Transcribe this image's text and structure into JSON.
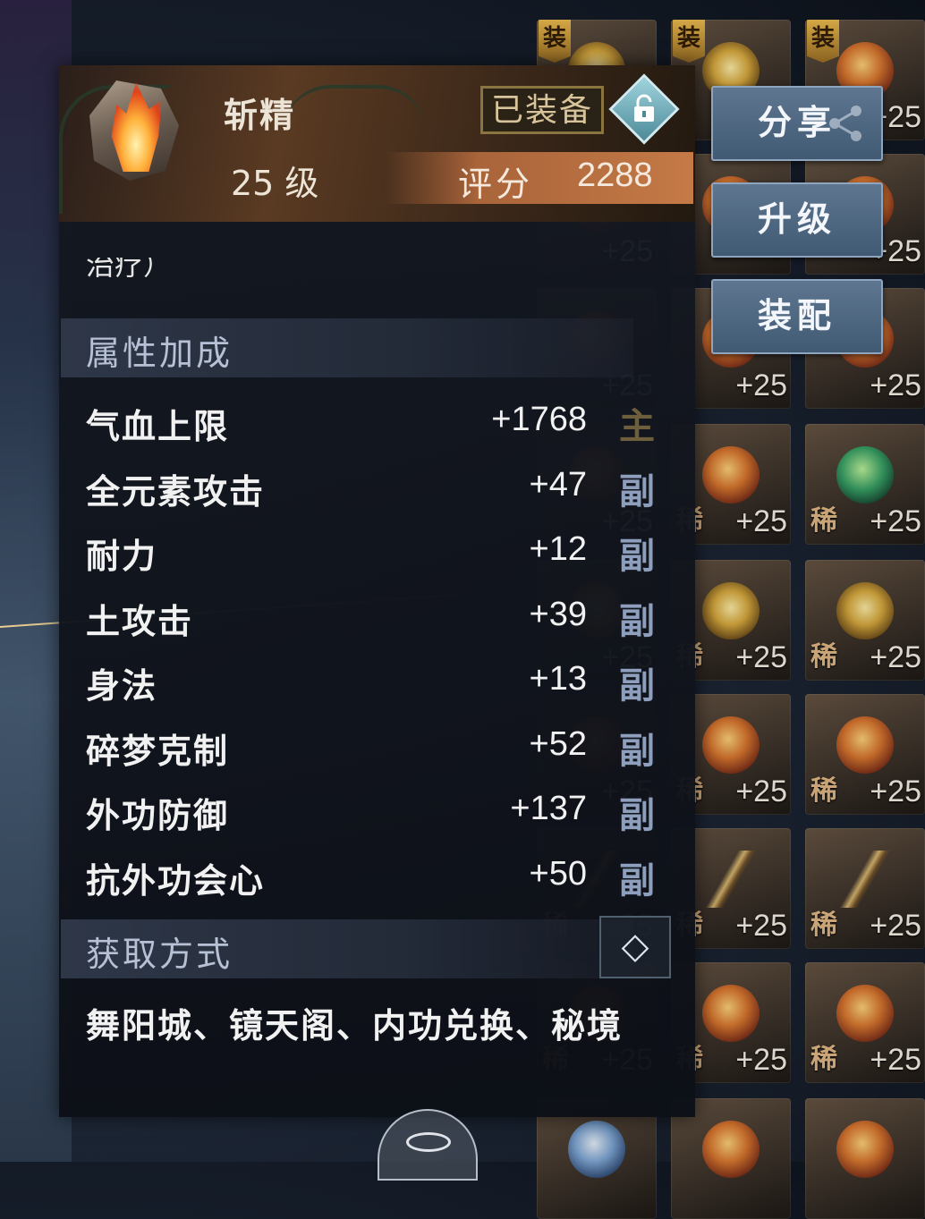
{
  "item": {
    "name": "斩精",
    "equipped_label": "已装备",
    "level_label": "25 级",
    "score_label": "评分",
    "score_value": "2288"
  },
  "description_clip": "治疗）",
  "attributes": {
    "section_title": "属性加成",
    "rows": [
      {
        "name": "气血上限",
        "value": "+1768",
        "tag": "主"
      },
      {
        "name": "全元素攻击",
        "value": "+47",
        "tag": "副"
      },
      {
        "name": "耐力",
        "value": "+12",
        "tag": "副"
      },
      {
        "name": "土攻击",
        "value": "+39",
        "tag": "副"
      },
      {
        "name": "身法",
        "value": "+13",
        "tag": "副"
      },
      {
        "name": "碎梦克制",
        "value": "+52",
        "tag": "副"
      },
      {
        "name": "外功防御",
        "value": "+137",
        "tag": "副"
      },
      {
        "name": "抗外功会心",
        "value": "+50",
        "tag": "副"
      }
    ]
  },
  "source": {
    "section_title": "获取方式",
    "text": "舞阳城、镜天阁、内功兑换、秘境",
    "expand_glyph": "◇"
  },
  "side_buttons": {
    "share": "分享",
    "upgrade": "升级",
    "assemble": "装配"
  },
  "inventory": {
    "equip_tag": "装",
    "rare_tag": "稀",
    "level_tag": "+25"
  },
  "icons": {
    "lock": "unlock-icon",
    "share": "share-icon",
    "expand": "diamond-arrow-icon",
    "eye": "eye-icon"
  }
}
